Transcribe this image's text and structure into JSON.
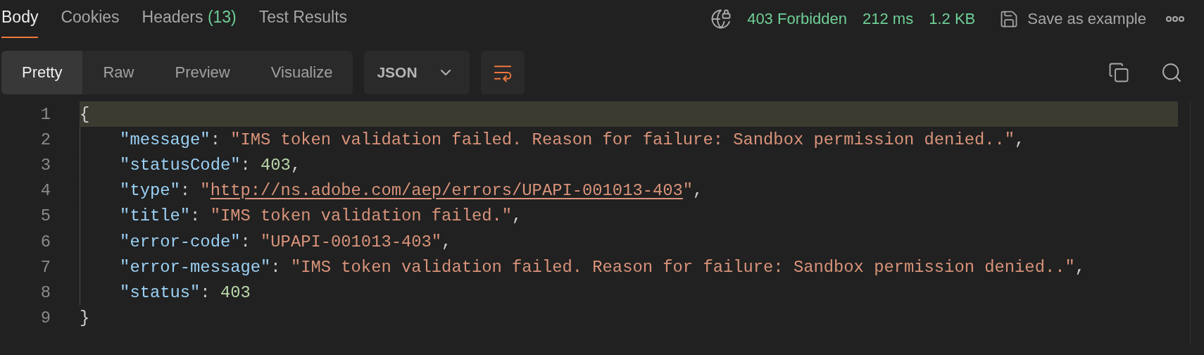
{
  "tabs": [
    {
      "label": "Body",
      "selected": true
    },
    {
      "label": "Cookies",
      "selected": false
    },
    {
      "label": "Headers",
      "count": "(13)",
      "selected": false
    },
    {
      "label": "Test Results",
      "selected": false
    }
  ],
  "status": {
    "code": "403 Forbidden",
    "time": "212 ms",
    "size": "1.2 KB",
    "save_label": "Save as example"
  },
  "view_modes": [
    {
      "label": "Pretty",
      "selected": true
    },
    {
      "label": "Raw",
      "selected": false
    },
    {
      "label": "Preview",
      "selected": false
    },
    {
      "label": "Visualize",
      "selected": false
    }
  ],
  "format": {
    "value": "JSON"
  },
  "wrap": {
    "on": true
  },
  "code": {
    "lines": [
      {
        "number": "1",
        "highlighted": true,
        "tokens": [
          {
            "kind": "punct",
            "text": "{"
          }
        ],
        "children": [
          {
            "number": "2",
            "highlighted": false,
            "tokens": [
              {
                "kind": "key",
                "text": "\"message\""
              },
              {
                "kind": "punct",
                "text": ": "
              },
              {
                "kind": "string",
                "text": "\"IMS token validation failed. Reason for failure: Sandbox permission denied..\""
              },
              {
                "kind": "punct",
                "text": ","
              }
            ]
          },
          {
            "number": "3",
            "highlighted": false,
            "tokens": [
              {
                "kind": "key",
                "text": "\"statusCode\""
              },
              {
                "kind": "punct",
                "text": ": "
              },
              {
                "kind": "number",
                "text": "403"
              },
              {
                "kind": "punct",
                "text": ","
              }
            ]
          },
          {
            "number": "4",
            "highlighted": false,
            "tokens": [
              {
                "kind": "key",
                "text": "\"type\""
              },
              {
                "kind": "punct",
                "text": ": "
              },
              {
                "kind": "string",
                "text": "\""
              },
              {
                "kind": "link",
                "text": "http://ns.adobe.com/aep/errors/UPAPI-001013-403"
              },
              {
                "kind": "string",
                "text": "\""
              },
              {
                "kind": "punct",
                "text": ","
              }
            ]
          },
          {
            "number": "5",
            "highlighted": false,
            "tokens": [
              {
                "kind": "key",
                "text": "\"title\""
              },
              {
                "kind": "punct",
                "text": ": "
              },
              {
                "kind": "string",
                "text": "\"IMS token validation failed.\""
              },
              {
                "kind": "punct",
                "text": ","
              }
            ]
          },
          {
            "number": "6",
            "highlighted": false,
            "tokens": [
              {
                "kind": "key",
                "text": "\"error-code\""
              },
              {
                "kind": "punct",
                "text": ": "
              },
              {
                "kind": "string",
                "text": "\"UPAPI-001013-403\""
              },
              {
                "kind": "punct",
                "text": ","
              }
            ]
          },
          {
            "number": "7",
            "highlighted": false,
            "tokens": [
              {
                "kind": "key",
                "text": "\"error-message\""
              },
              {
                "kind": "punct",
                "text": ": "
              },
              {
                "kind": "string",
                "text": "\"IMS token validation failed. Reason for failure: Sandbox permission denied..\""
              },
              {
                "kind": "punct",
                "text": ","
              }
            ]
          },
          {
            "number": "8",
            "highlighted": false,
            "tokens": [
              {
                "kind": "key",
                "text": "\"status\""
              },
              {
                "kind": "punct",
                "text": ": "
              },
              {
                "kind": "number",
                "text": "403"
              }
            ]
          }
        ]
      },
      {
        "number": "9",
        "highlighted": false,
        "tokens": [
          {
            "kind": "punct",
            "text": "}"
          }
        ]
      }
    ]
  }
}
